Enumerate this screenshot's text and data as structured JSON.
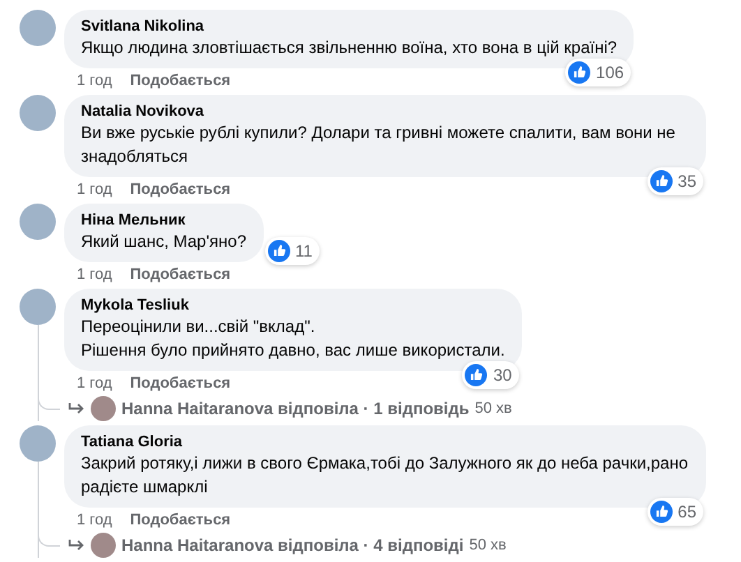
{
  "comments": [
    {
      "author": "Svitlana Nikolina",
      "text": "Якщо людина зловтішається звільненню воїна, хто вона в цій країні?",
      "time": "1 год",
      "like_label": "Подобається",
      "reactions": "106",
      "kind": "overlap"
    },
    {
      "author": "Natalia Novikova",
      "text": "Ви вже руськіе рублі купили? Долари та гривні можете спалити, вам вони не знадобляться",
      "time": "1 год",
      "like_label": "Подобається",
      "reactions": "35",
      "kind": "overlap"
    },
    {
      "author": "Ніна Мельник",
      "text": "Який шанс, Мар'яно?",
      "time": "1 год",
      "like_label": "Подобається",
      "reactions": "11",
      "kind": "inline"
    },
    {
      "author": "Mykola Tesliuk",
      "text": "Переоцінили ви...свій \"вклад\".\nРішення було прийнято давно, вас лише використали.",
      "time": "1 год",
      "like_label": "Подобається",
      "reactions": "30",
      "kind": "overlap",
      "replies": {
        "text": "Hanna Haitaranova відповіла · 1 відповідь",
        "time": "50 хв"
      }
    },
    {
      "author": "Tatiana Gloria",
      "text": "Закрий ротяку,і лижи в свого Єрмака,тобі до Залужного як до неба рачки,рано радієте шмарклі",
      "time": "1 год",
      "like_label": "Подобається",
      "reactions": "65",
      "kind": "overlap",
      "replies": {
        "text": "Hanna Haitaranova відповіла · 4 відповіді",
        "time": "50 хв"
      }
    }
  ]
}
